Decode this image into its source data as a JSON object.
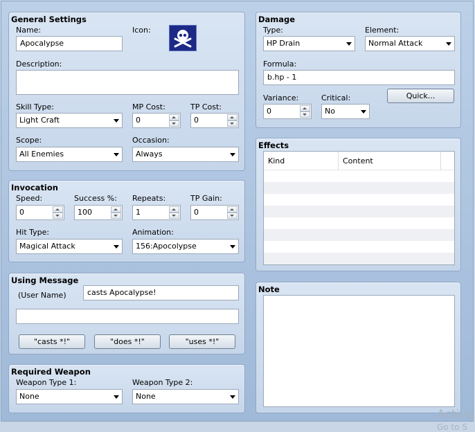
{
  "general": {
    "title": "General Settings",
    "name_label": "Name:",
    "name_value": "Apocalypse",
    "icon_label": "Icon:",
    "icon_name": "skull-crossbones-icon",
    "description_label": "Description:",
    "description_value": "",
    "skill_type_label": "Skill Type:",
    "skill_type_value": "Light Craft",
    "mp_cost_label": "MP Cost:",
    "mp_cost_value": "0",
    "tp_cost_label": "TP Cost:",
    "tp_cost_value": "0",
    "scope_label": "Scope:",
    "scope_value": "All Enemies",
    "occasion_label": "Occasion:",
    "occasion_value": "Always"
  },
  "invocation": {
    "title": "Invocation",
    "speed_label": "Speed:",
    "speed_value": "0",
    "success_label": "Success %:",
    "success_value": "100",
    "repeats_label": "Repeats:",
    "repeats_value": "1",
    "tp_gain_label": "TP Gain:",
    "tp_gain_value": "0",
    "hit_type_label": "Hit Type:",
    "hit_type_value": "Magical Attack",
    "animation_label": "Animation:",
    "animation_value": "156:Apocolypse"
  },
  "message": {
    "title": "Using Message",
    "user_name_label": "(User Name)",
    "line1_value": "casts Apocalypse!",
    "line2_value": "",
    "casts_button": "\"casts *!\"",
    "does_button": "\"does *!\"",
    "uses_button": "\"uses *!\""
  },
  "weapon": {
    "title": "Required Weapon",
    "type1_label": "Weapon Type 1:",
    "type1_value": "None",
    "type2_label": "Weapon Type 2:",
    "type2_value": "None"
  },
  "damage": {
    "title": "Damage",
    "type_label": "Type:",
    "type_value": "HP Drain",
    "element_label": "Element:",
    "element_value": "Normal Attack",
    "formula_label": "Formula:",
    "formula_value": "b.hp - 1",
    "variance_label": "Variance:",
    "variance_value": "0",
    "critical_label": "Critical:",
    "critical_value": "No",
    "quick_button": "Quick..."
  },
  "effects": {
    "title": "Effects",
    "col_kind": "Kind",
    "col_content": "Content"
  },
  "note": {
    "title": "Note",
    "value": ""
  },
  "watermark": {
    "line1": "Activa",
    "line2": "Go to S"
  }
}
